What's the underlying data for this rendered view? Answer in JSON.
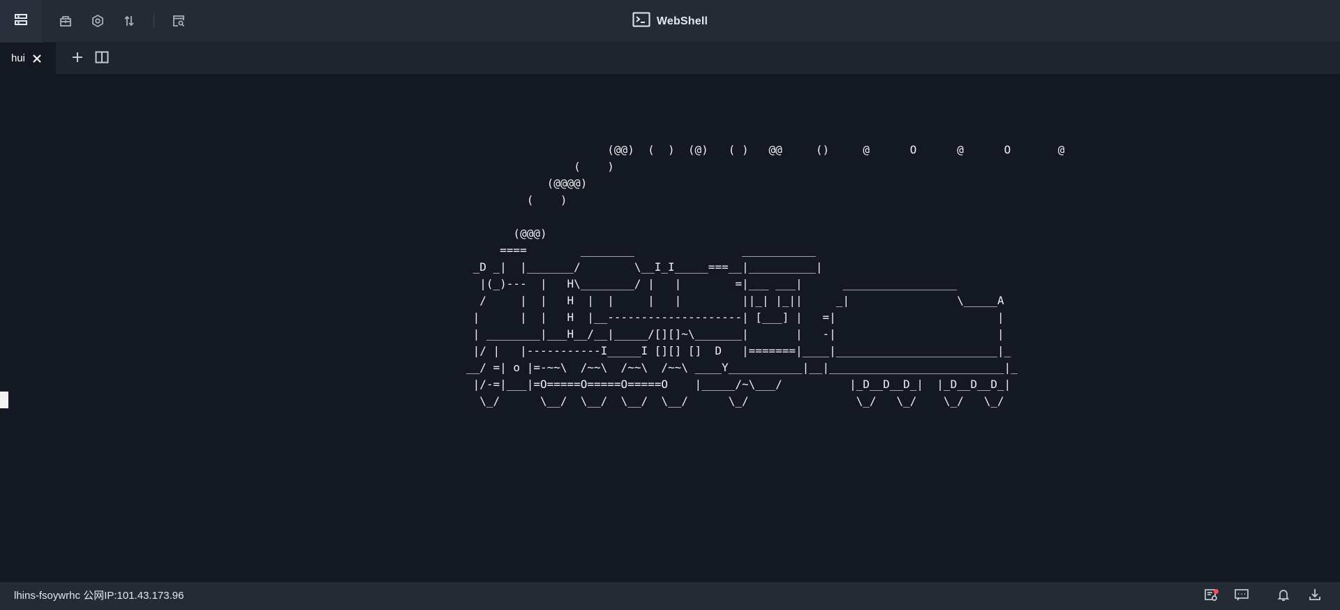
{
  "app": {
    "title": "WebShell"
  },
  "toolbar": {
    "icons": [
      "server-list-icon",
      "package-icon",
      "settings-icon",
      "transfer-icon",
      "search-window-icon"
    ]
  },
  "tabs": [
    {
      "label": "hui",
      "active": true
    }
  ],
  "terminal": {
    "lines": [
      "                     (@@)  (  )  (@)   ( )   @@     ()     @      O      @      O       @",
      "                (    )",
      "            (@@@@)",
      "         (    )",
      "",
      "       (@@@)",
      "     ====        ________                ___________",
      " _D _|  |_______/        \\__I_I_____===__|__________|",
      "  |(_)---  |   H\\________/ |   |        =|___ ___|      _________________",
      "  /     |  |   H  |  |     |   |         ||_| |_||     _|                \\_____A",
      " |      |  |   H  |__--------------------| [___] |   =|                        |",
      " | ________|___H__/__|_____/[][]~\\_______|       |   -|                        |",
      " |/ |   |-----------I_____I [][] []  D   |=======|____|________________________|_",
      "__/ =| o |=-~~\\  /~~\\  /~~\\  /~~\\ ____Y___________|__|__________________________|_",
      " |/-=|___|=O=====O=====O=====O    |_____/~\\___/          |_D__D__D_|  |_D__D__D_|",
      "  \\_/      \\__/  \\__/  \\__/  \\__/      \\_/                \\_/   \\_/    \\_/   \\_/"
    ]
  },
  "status": {
    "host": "lhins-fsoywrhc 公网IP:101.43.173.96"
  },
  "colors": {
    "background": "#141822",
    "toolbar": "#252b35",
    "notification": "#ff4d4f"
  }
}
